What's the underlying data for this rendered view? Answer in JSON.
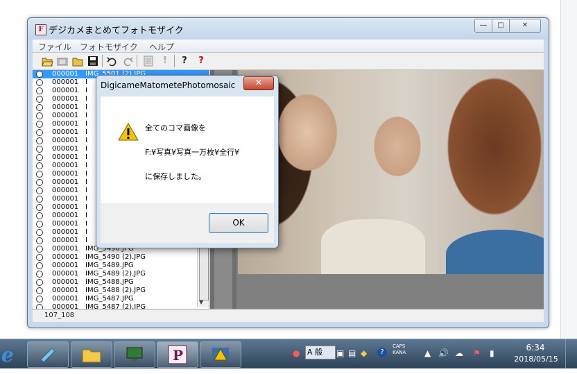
{
  "window": {
    "title": "デジカメまとめてフォトモザイク",
    "controls": {
      "min": "―",
      "max": "□",
      "close": "✕"
    }
  },
  "menu": {
    "items": [
      "ファイル",
      "フォトモザイク",
      "ヘルプ"
    ]
  },
  "toolbar": {
    "buttons": [
      "open-folder",
      "film",
      "folder",
      "save",
      "undo",
      "redo",
      "page",
      "info",
      "help",
      "help-red"
    ]
  },
  "list": {
    "selected_index": 0,
    "rows": [
      {
        "num": "000001",
        "name": "IMG_5501 (2).JPG"
      },
      {
        "num": "000001",
        "name": "I"
      },
      {
        "num": "000001",
        "name": "I"
      },
      {
        "num": "000001",
        "name": "I"
      },
      {
        "num": "000001",
        "name": "I"
      },
      {
        "num": "000001",
        "name": "I"
      },
      {
        "num": "000001",
        "name": "I"
      },
      {
        "num": "000001",
        "name": "I"
      },
      {
        "num": "000001",
        "name": "I"
      },
      {
        "num": "000001",
        "name": "I"
      },
      {
        "num": "000001",
        "name": "I"
      },
      {
        "num": "000001",
        "name": "I"
      },
      {
        "num": "000001",
        "name": "I"
      },
      {
        "num": "000001",
        "name": "I"
      },
      {
        "num": "000001",
        "name": "I"
      },
      {
        "num": "000001",
        "name": "I"
      },
      {
        "num": "000001",
        "name": "I"
      },
      {
        "num": "000001",
        "name": "I"
      },
      {
        "num": "000001",
        "name": "I"
      },
      {
        "num": "000001",
        "name": "I"
      },
      {
        "num": "000001",
        "name": "I"
      },
      {
        "num": "000001",
        "name": "IMG_5490.JPG"
      },
      {
        "num": "000001",
        "name": "IMG_5490 (2).JPG"
      },
      {
        "num": "000001",
        "name": "IMG_5489.JPG"
      },
      {
        "num": "000001",
        "name": "IMG_5489 (2).JPG"
      },
      {
        "num": "000001",
        "name": "IMG_5488.JPG"
      },
      {
        "num": "000001",
        "name": "IMG_5488 (2).JPG"
      },
      {
        "num": "000001",
        "name": "IMG_5487.JPG"
      },
      {
        "num": "000001",
        "name": "IMG_5487 (2).JPG"
      }
    ]
  },
  "status": {
    "text": "107_108"
  },
  "dialog": {
    "title": "DigicameMatometePhotomosaic",
    "close": "✕",
    "line1": "全てのコマ画像を",
    "line2": "F:¥写真¥写真一万枚¥全行¥",
    "line3": "に保存しました。",
    "ok": "OK"
  },
  "taskbar": {
    "ie": "e",
    "tray": {
      "ime": "A 般",
      "caps": "CAPS",
      "kana": "KANA",
      "help": "?"
    },
    "time": "6:34",
    "date": "2018/05/15"
  }
}
